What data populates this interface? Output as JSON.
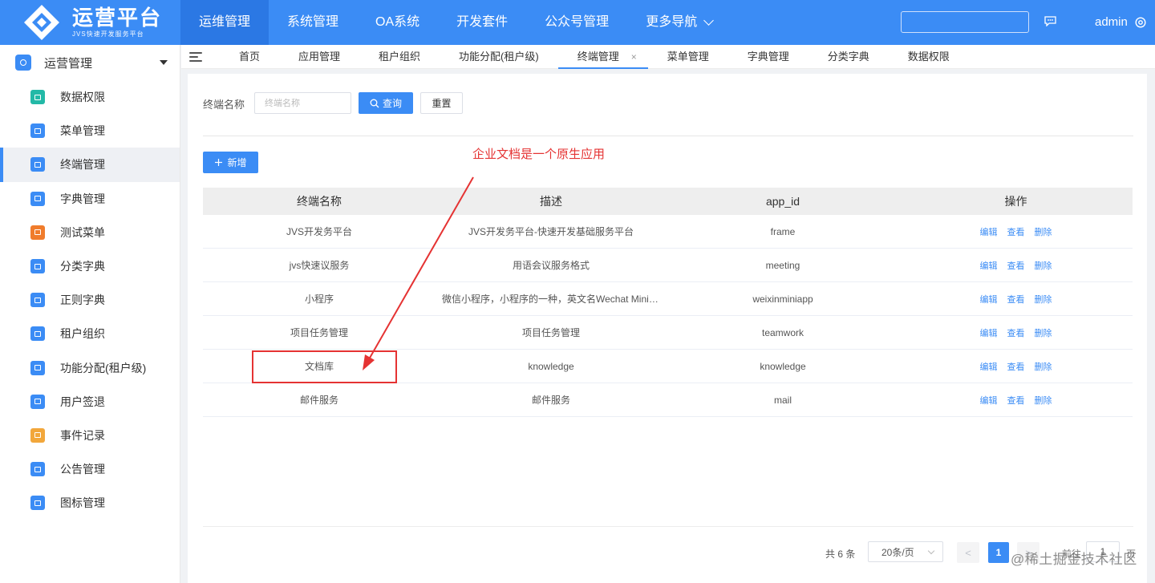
{
  "header": {
    "logo_title": "运营平台",
    "logo_subtitle": "JVS快速开发服务平台",
    "nav": [
      {
        "label": "运维管理",
        "active": true
      },
      {
        "label": "系统管理",
        "active": false
      },
      {
        "label": "OA系统",
        "active": false
      },
      {
        "label": "开发套件",
        "active": false
      },
      {
        "label": "公众号管理",
        "active": false
      },
      {
        "label": "更多导航",
        "active": false
      }
    ],
    "search_value": "",
    "user": "admin",
    "brand_color": "#3b8cf5"
  },
  "sidebar": {
    "title": "运营管理",
    "items": [
      {
        "label": "数据权限",
        "icon": "database-icon",
        "color": "#23b9a7"
      },
      {
        "label": "菜单管理",
        "icon": "menu-icon",
        "color": "#3b8cf5"
      },
      {
        "label": "终端管理",
        "icon": "terminal-icon",
        "color": "#3b8cf5",
        "active": true
      },
      {
        "label": "字典管理",
        "icon": "dictionary-icon",
        "color": "#3b8cf5"
      },
      {
        "label": "测试菜单",
        "icon": "home-icon",
        "color": "#f07c2c"
      },
      {
        "label": "分类字典",
        "icon": "chart-icon",
        "color": "#3b8cf5"
      },
      {
        "label": "正则字典",
        "icon": "globe-icon",
        "color": "#3b8cf5"
      },
      {
        "label": "租户组织",
        "icon": "org-icon",
        "color": "#3b8cf5"
      },
      {
        "label": "功能分配(租户级)",
        "icon": "function-icon",
        "color": "#3b8cf5"
      },
      {
        "label": "用户签退",
        "icon": "logout-icon",
        "color": "#3b8cf5"
      },
      {
        "label": "事件记录",
        "icon": "event-icon",
        "color": "#f2a73b"
      },
      {
        "label": "公告管理",
        "icon": "notice-icon",
        "color": "#3b8cf5"
      },
      {
        "label": "图标管理",
        "icon": "icon-manage-icon",
        "color": "#3b8cf5"
      }
    ]
  },
  "tabs": [
    {
      "label": "首页"
    },
    {
      "label": "应用管理"
    },
    {
      "label": "租户组织"
    },
    {
      "label": "功能分配(租户级)"
    },
    {
      "label": "终端管理",
      "active": true,
      "close": "×"
    },
    {
      "label": "菜单管理"
    },
    {
      "label": "字典管理"
    },
    {
      "label": "分类字典"
    },
    {
      "label": "数据权限"
    }
  ],
  "filter": {
    "label": "终端名称",
    "placeholder": "终端名称",
    "query_label": "查询",
    "reset_label": "重置"
  },
  "add_label": "新增",
  "annotation": "企业文档是一个原生应用",
  "table": {
    "columns": [
      "终端名称",
      "描述",
      "app_id",
      "操作"
    ],
    "rows": [
      {
        "name": "JVS开发务平台",
        "desc": "JVS开发务平台-快速开发基础服务平台",
        "app_id": "frame"
      },
      {
        "name": "jvs快速议服务",
        "desc": "用语会议服务格式",
        "app_id": "meeting"
      },
      {
        "name": "小程序",
        "desc": "微信小程序，小程序的一种，英文名Wechat Mini P...",
        "app_id": "weixinminiapp"
      },
      {
        "name": "项目任务管理",
        "desc": "项目任务管理",
        "app_id": "teamwork"
      },
      {
        "name": "文档库",
        "desc": "knowledge",
        "app_id": "knowledge"
      },
      {
        "name": "邮件服务",
        "desc": "邮件服务",
        "app_id": "mail"
      }
    ],
    "actions": [
      "编辑",
      "查看",
      "删除"
    ]
  },
  "pager": {
    "total": "共 6 条",
    "page_size": "20条/页",
    "prev": "<",
    "current": "1",
    "next": ">",
    "goto": "前往",
    "jump_value": "1",
    "page_suffix": "页"
  },
  "watermark": "@稀土掘金技术社区"
}
